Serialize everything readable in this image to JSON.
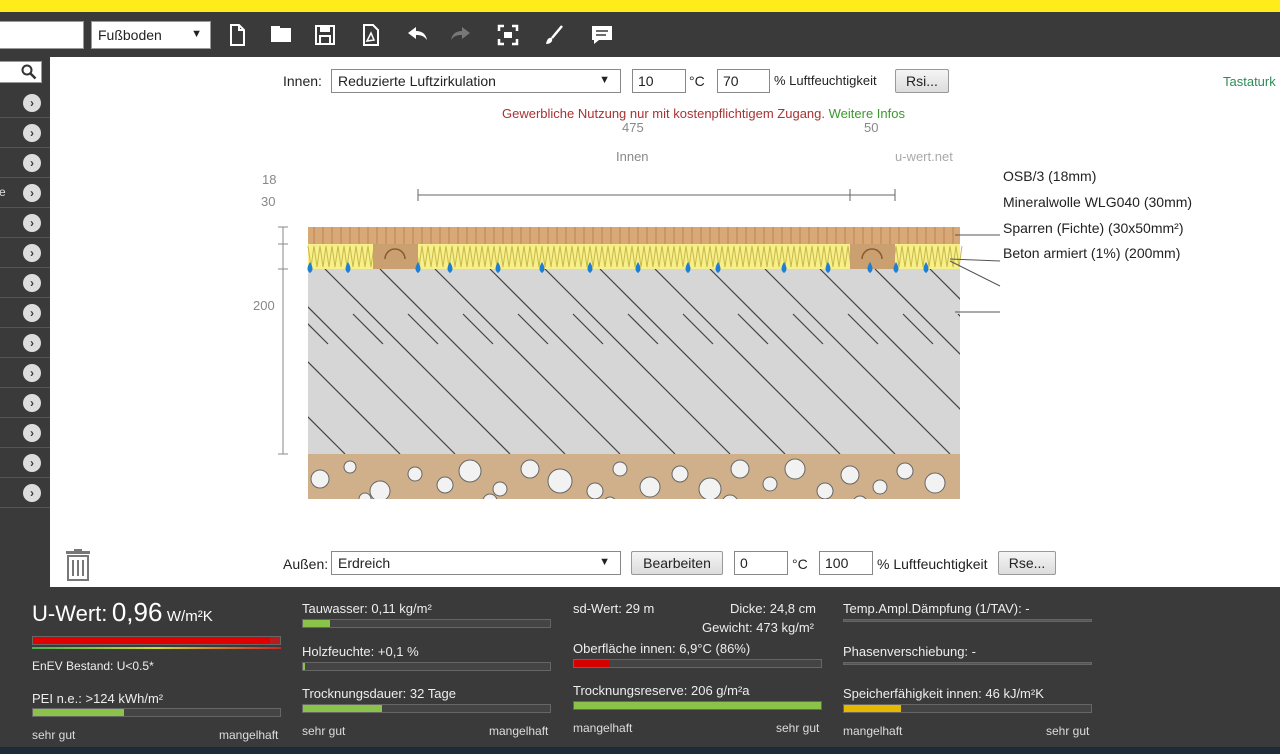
{
  "toolbar": {
    "type_select": "Fußboden",
    "icons": [
      "new-file-icon",
      "open-folder-icon",
      "save-icon",
      "pdf-icon",
      "undo-icon",
      "redo-icon",
      "fullscreen-icon",
      "brush-icon",
      "comment-icon"
    ]
  },
  "sidebar": {
    "row_count": 14,
    "truncated_text": "e"
  },
  "inside": {
    "label": "Innen:",
    "condition": "Reduzierte Luftzirkulation",
    "temp": "10",
    "temp_unit": "°C",
    "humidity": "70",
    "humidity_unit": "% Luftfeuchtigkeit",
    "rsi_button": "Rsi..."
  },
  "keyboard_link": "Tastaturk",
  "notice": {
    "text": "Gewerbliche Nutzung nur mit kostenpflichtigem Zugang.",
    "link": "Weitere Infos"
  },
  "diagram": {
    "dim_main": "475",
    "dim_side": "50",
    "side_inner": "Innen",
    "watermark": "u-wert.net",
    "thickness_labels": [
      "18",
      "30",
      "200"
    ],
    "layers": [
      "OSB/3 (18mm)",
      "Mineralwolle WLG040 (30mm)",
      "Sparren (Fichte) (30x50mm²)",
      "Beton armiert (1%) (200mm)"
    ]
  },
  "outside": {
    "label": "Außen:",
    "condition": "Erdreich",
    "edit_button": "Bearbeiten",
    "temp": "0",
    "temp_unit": "°C",
    "humidity": "100",
    "humidity_unit": "% Luftfeuchtigkeit",
    "rse_button": "Rse..."
  },
  "results": {
    "uwert_label": "U-Wert:",
    "uwert_value": "0,96",
    "uwert_unit": "W/m²K",
    "enev": "EnEV Bestand: U<0.5*",
    "pei": "PEI n.e.: >124 kWh/m²",
    "tauwasser": "Tauwasser: 0,11 kg/m²",
    "holzfeuchte": "Holzfeuchte: +0,1 %",
    "trocknungsdauer": "Trocknungsdauer: 32 Tage",
    "sd_wert": "sd-Wert: 29 m",
    "dicke": "Dicke: 24,8 cm",
    "gewicht": "Gewicht: 473 kg/m²",
    "oberflaeche": "Oberfläche innen: 6,9°C (86%)",
    "trocknungsreserve": "Trocknungsreserve: 206 g/m²a",
    "temp_ampl": "Temp.Ampl.Dämpfung (1/TAV): -",
    "phasen": "Phasenverschiebung: -",
    "speicher": "Speicherfähigkeit innen: 46 kJ/m²K",
    "scale_good": "sehr gut",
    "scale_bad": "mangelhaft",
    "levels": {
      "uwert": 0.96,
      "pei": 0.37,
      "tauwasser": 0.11,
      "holzfeuchte": 0.01,
      "trocknungsdauer": 0.32,
      "oberflaeche": 0.14,
      "trocknungsreserve": 1.0,
      "speicher": 0.23
    },
    "colors": {
      "good": "#8bc34a",
      "bad": "#c62828",
      "warn": "#ffc107"
    }
  }
}
